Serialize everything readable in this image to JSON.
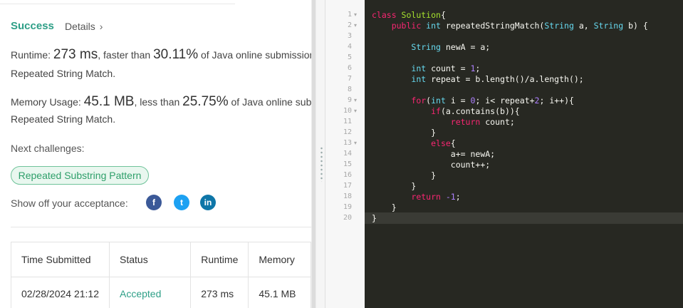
{
  "result": {
    "status": "Success",
    "details_label": "Details",
    "chevron": "›"
  },
  "runtime": {
    "label": "Runtime: ",
    "value": "273 ms",
    "mid": ", faster than ",
    "percent": "30.11%",
    "tail": " of Java online submissions for",
    "line2": "Repeated String Match."
  },
  "memory": {
    "label": "Memory Usage: ",
    "value": "45.1 MB",
    "mid": ", less than ",
    "percent": "25.75%",
    "tail": " of Java online submissions for",
    "line2": "Repeated String Match."
  },
  "next": {
    "label": "Next challenges:",
    "challenge": "Repeated Substring Pattern"
  },
  "share": {
    "label": "Show off your acceptance:",
    "icons": [
      "facebook-icon",
      "twitter-icon",
      "linkedin-icon"
    ],
    "glyphs": [
      "f",
      "t",
      "in"
    ]
  },
  "submissions": {
    "headers": [
      "Time Submitted",
      "Status",
      "Runtime",
      "Memory"
    ],
    "rows": [
      [
        "02/28/2024 21:12",
        "Accepted",
        "273 ms",
        "45.1 MB"
      ]
    ]
  },
  "editor": {
    "line_numbers": [
      "1",
      "2",
      "3",
      "4",
      "5",
      "6",
      "7",
      "8",
      "9",
      "10",
      "11",
      "12",
      "13",
      "14",
      "15",
      "16",
      "17",
      "18",
      "19",
      "20"
    ],
    "code": [
      [
        [
          "kw",
          "class "
        ],
        [
          "cn",
          "Solution"
        ],
        [
          "",
          "{"
        ]
      ],
      [
        [
          "",
          "    "
        ],
        [
          "kw",
          "public "
        ],
        [
          "ty",
          "int "
        ],
        [
          "",
          "repeatedStringMatch("
        ],
        [
          "ty",
          "String "
        ],
        [
          "",
          "a, "
        ],
        [
          "ty",
          "String "
        ],
        [
          "",
          "b) {"
        ]
      ],
      [],
      [
        [
          "",
          "        "
        ],
        [
          "ty",
          "String "
        ],
        [
          "",
          "newA = a;"
        ]
      ],
      [],
      [
        [
          "",
          "        "
        ],
        [
          "ty",
          "int "
        ],
        [
          "",
          "count = "
        ],
        [
          "nu",
          "1"
        ],
        [
          "",
          ";"
        ]
      ],
      [
        [
          "",
          "        "
        ],
        [
          "ty",
          "int "
        ],
        [
          "",
          "repeat = b.length()/a.length();"
        ]
      ],
      [],
      [
        [
          "",
          "        "
        ],
        [
          "kw",
          "for"
        ],
        [
          "",
          "("
        ],
        [
          "ty",
          "int "
        ],
        [
          "",
          "i = "
        ],
        [
          "nu",
          "0"
        ],
        [
          "",
          "; i< repeat+"
        ],
        [
          "nu",
          "2"
        ],
        [
          "",
          "; i++){"
        ]
      ],
      [
        [
          "",
          "            "
        ],
        [
          "kw",
          "if"
        ],
        [
          "",
          "(a.contains(b)){"
        ]
      ],
      [
        [
          "",
          "                "
        ],
        [
          "kw",
          "return "
        ],
        [
          "",
          "count;"
        ]
      ],
      [
        [
          "",
          "            }"
        ]
      ],
      [
        [
          "",
          "            "
        ],
        [
          "kw",
          "else"
        ],
        [
          "",
          "{"
        ]
      ],
      [
        [
          "",
          "                a+= newA;"
        ]
      ],
      [
        [
          "",
          "                count++;"
        ]
      ],
      [
        [
          "",
          "            }"
        ]
      ],
      [
        [
          "",
          "        }"
        ]
      ],
      [
        [
          "",
          "        "
        ],
        [
          "kw",
          "return "
        ],
        [
          "nu",
          "-1"
        ],
        [
          "",
          ";"
        ]
      ],
      [
        [
          "",
          "    }"
        ]
      ],
      [
        [
          "",
          "}"
        ]
      ]
    ]
  }
}
